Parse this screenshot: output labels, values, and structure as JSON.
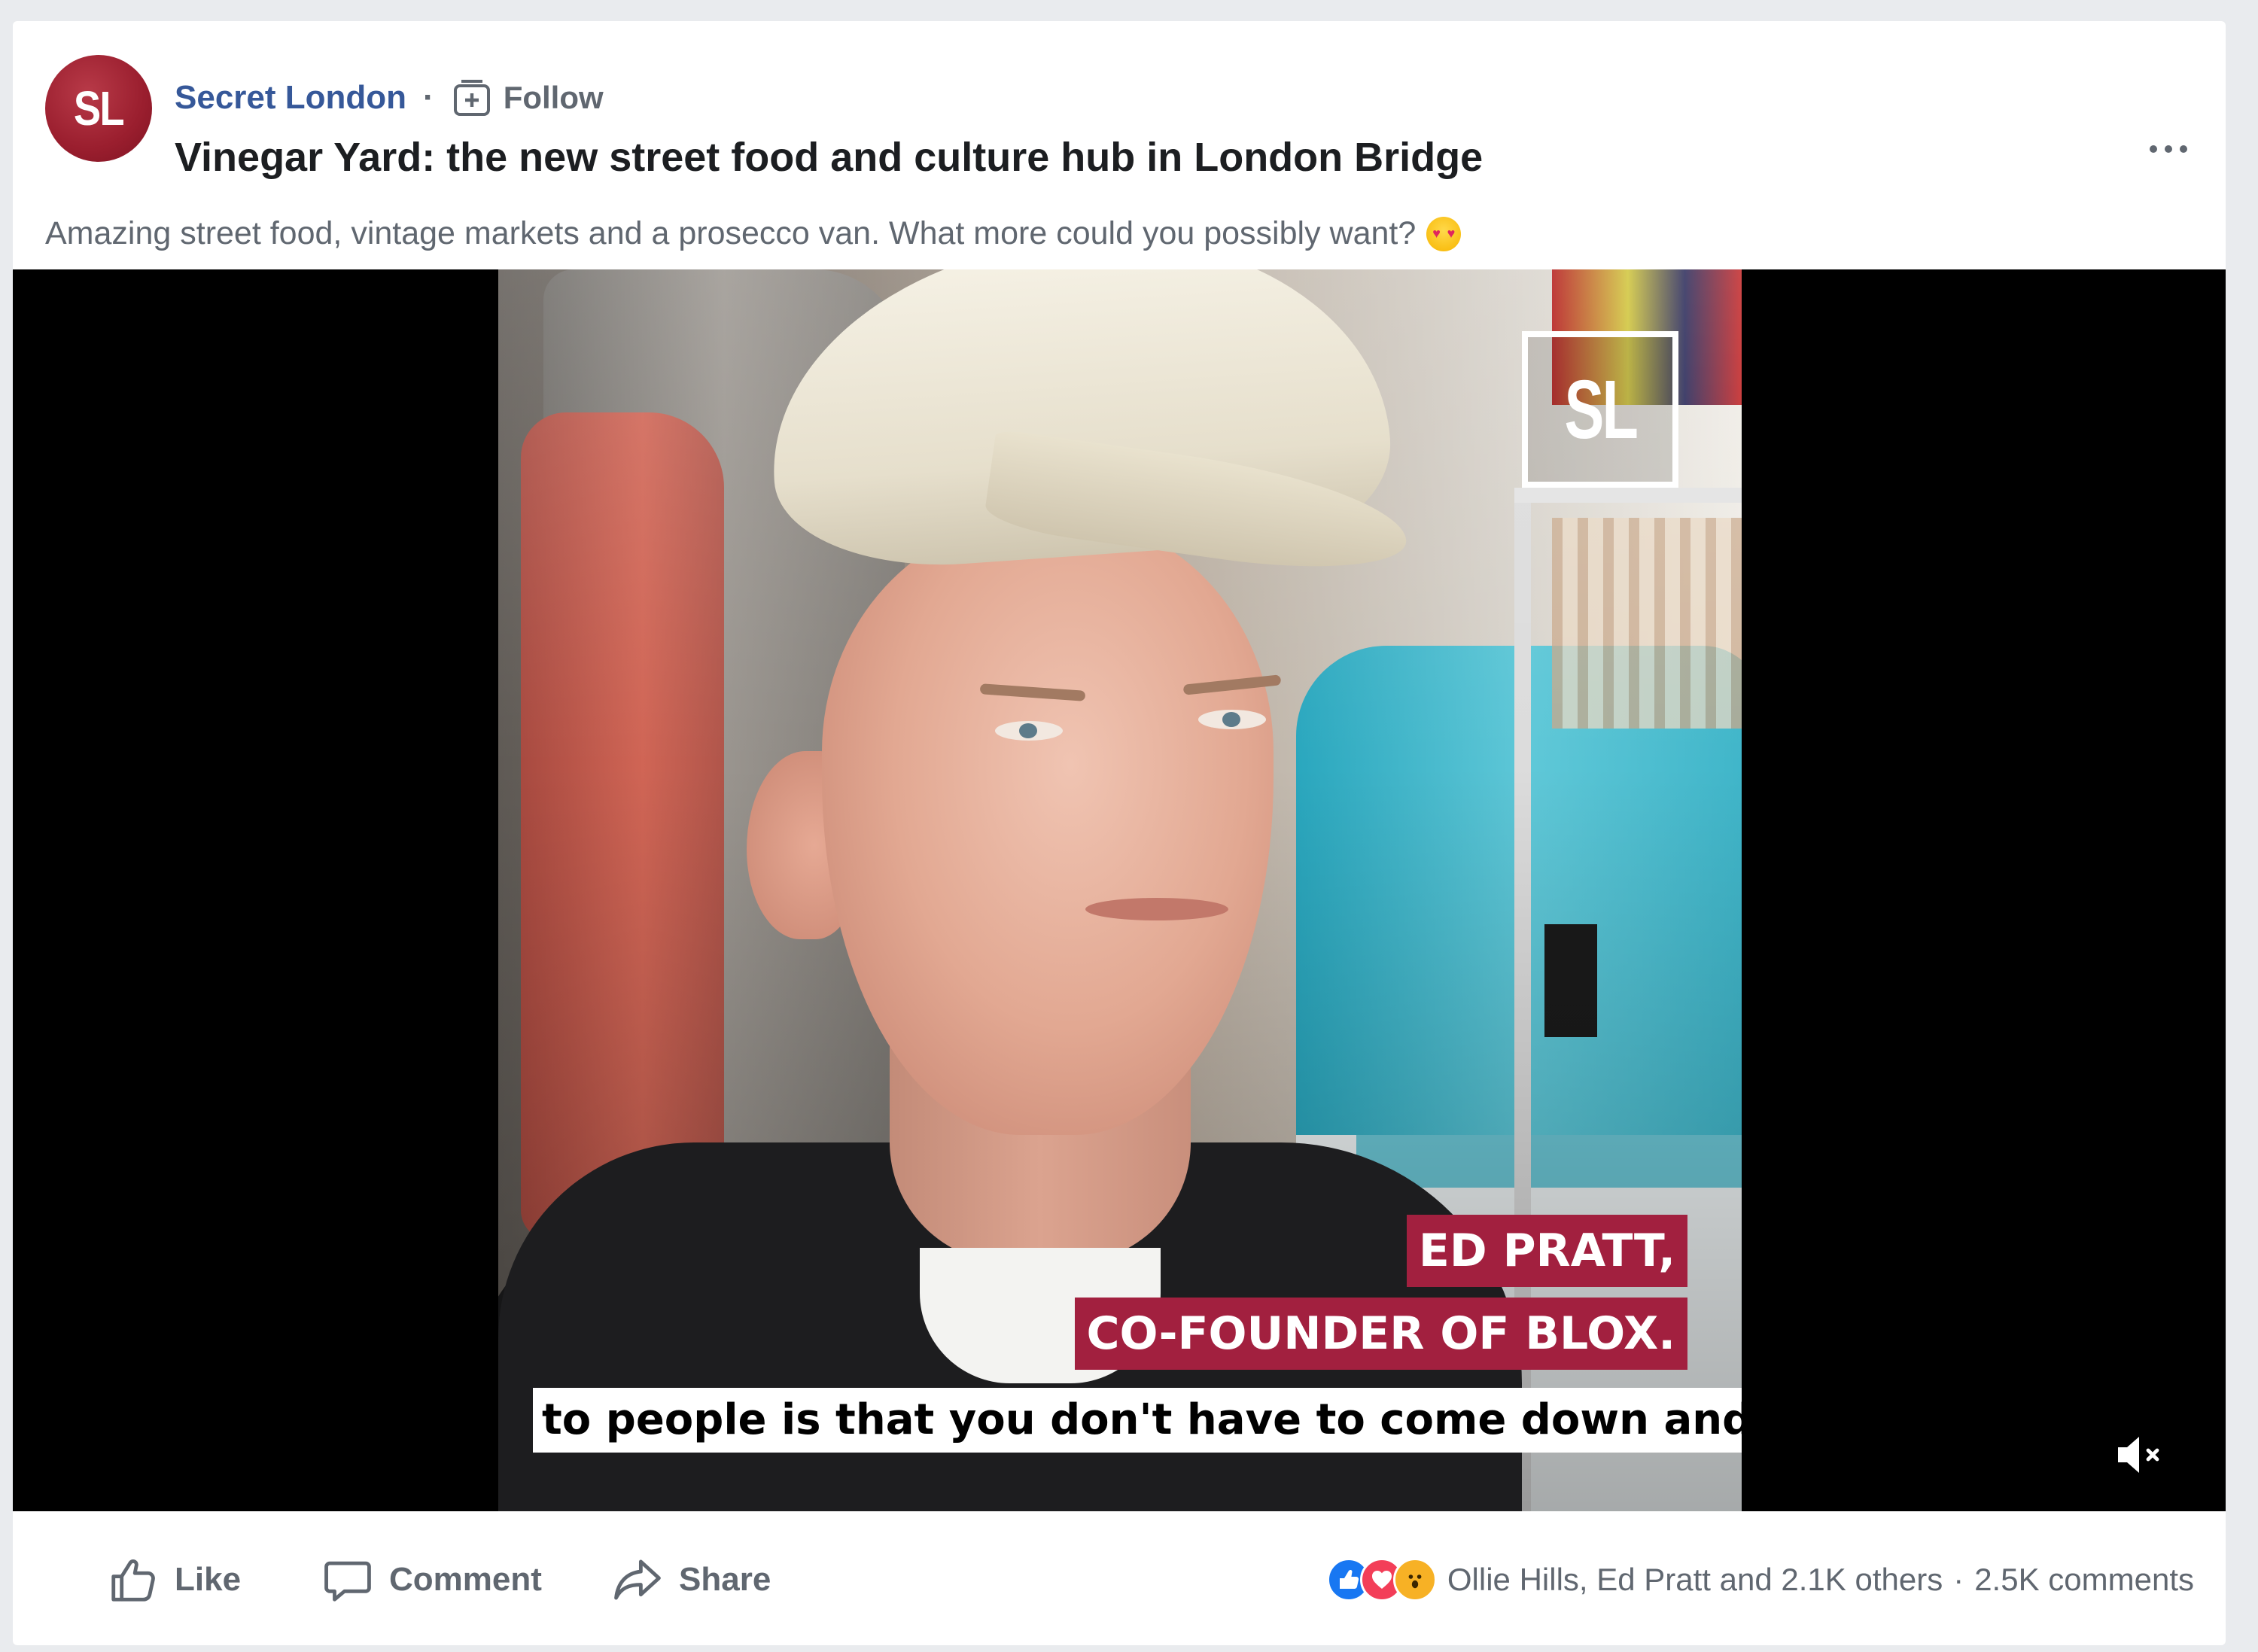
{
  "post": {
    "page_name": "Secret London",
    "avatar_text": "SL",
    "separator": "·",
    "follow_label": "Follow",
    "title": "Vinegar Yard: the new street food and culture hub in London Bridge",
    "caption": "Amazing street food, vintage markets and a prosecco van. What more could you possibly want?",
    "caption_emoji": "heart-eyes-emoji"
  },
  "video": {
    "watermark": "SL",
    "lower_third_line1": "ED PRATT,",
    "lower_third_line2": "CO-FOUNDER OF BLOX.",
    "subtitle": "to people is that you don't have to come down and",
    "muted": true
  },
  "actions": {
    "like_label": "Like",
    "comment_label": "Comment",
    "share_label": "Share"
  },
  "engagement": {
    "reaction_types": [
      "like",
      "love",
      "wow"
    ],
    "reactors_text": "Ollie Hills, Ed Pratt and 2.1K others",
    "separator": "·",
    "comments_text": "2.5K comments"
  },
  "colors": {
    "page_link": "#365899",
    "brand_red": "#a2203f",
    "background": "#e9ebee",
    "muted_text": "#606770"
  }
}
